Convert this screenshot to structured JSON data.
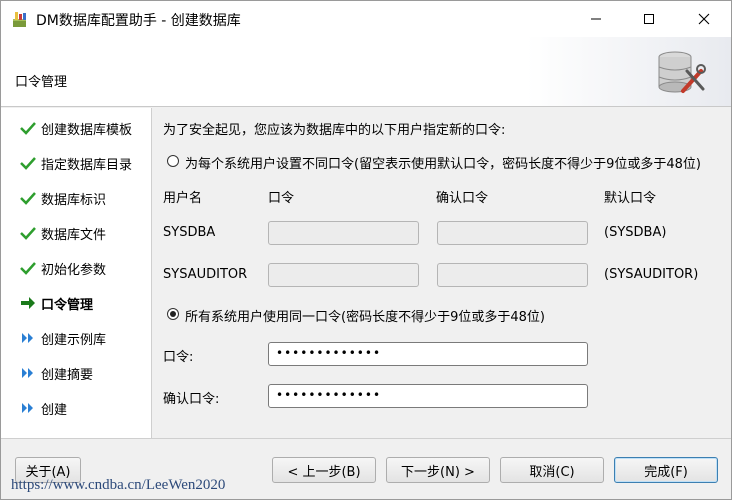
{
  "window": {
    "title": "DM数据库配置助手 - 创建数据库",
    "icons": {
      "app": "database-app-icon",
      "minimize": "minimize-icon",
      "maximize": "maximize-icon",
      "close": "close-icon"
    }
  },
  "header": {
    "title": "口令管理",
    "logo": "database-tools-icon"
  },
  "nav": {
    "items": [
      {
        "label": "创建数据库模板",
        "status": "done"
      },
      {
        "label": "指定数据库目录",
        "status": "done"
      },
      {
        "label": "数据库标识",
        "status": "done"
      },
      {
        "label": "数据库文件",
        "status": "done"
      },
      {
        "label": "初始化参数",
        "status": "done"
      },
      {
        "label": "口令管理",
        "status": "current"
      },
      {
        "label": "创建示例库",
        "status": "pending"
      },
      {
        "label": "创建摘要",
        "status": "pending"
      },
      {
        "label": "创建",
        "status": "pending"
      }
    ],
    "status_colors": {
      "done": "#2e9e2e",
      "current": "#1a7a1a",
      "pending": "#2a7fd4"
    }
  },
  "main": {
    "intro": "为了安全起见，您应该为数据库中的以下用户指定新的口令:",
    "option_different": {
      "label": "为每个系统用户设置不同口令(留空表示使用默认口令，密码长度不得少于9位或多于48位)",
      "selected": false
    },
    "table": {
      "headers": {
        "user": "用户名",
        "password": "口令",
        "confirm": "确认口令",
        "default": "默认口令"
      },
      "rows": [
        {
          "user": "SYSDBA",
          "password": "",
          "confirm": "",
          "default": "(SYSDBA)"
        },
        {
          "user": "SYSAUDITOR",
          "password": "",
          "confirm": "",
          "default": "(SYSAUDITOR)"
        }
      ]
    },
    "option_same": {
      "label": "所有系统用户使用同一口令(密码长度不得少于9位或多于48位)",
      "selected": true
    },
    "password_label": "口令:",
    "password_value": "•••••••••••••",
    "confirm_label": "确认口令:",
    "confirm_value": "•••••••••••••"
  },
  "footer": {
    "about": "关于(A)",
    "prev": "< 上一步(B)",
    "next": "下一步(N) >",
    "cancel": "取消(C)",
    "finish": "完成(F)"
  },
  "watermark": "https://www.cndba.cn/LeeWen2020"
}
